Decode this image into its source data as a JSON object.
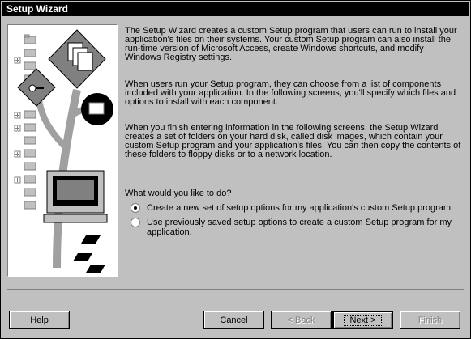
{
  "window": {
    "title": "Setup Wizard"
  },
  "intro": {
    "p1": "The Setup Wizard creates a custom Setup program that users can run to install your application's files on their systems.  Your custom Setup program can also install the run-time version of Microsoft Access, create Windows shortcuts, and modify Windows Registry settings.",
    "p2": "When users run your Setup program, they can choose from a list of components included with your application.  In the following screens, you'll specify which files and options to install with each component.",
    "p3": "When you finish entering information in the following screens, the Setup Wizard creates a set of folders on your hard disk, called disk images, which contain your custom Setup program and your application's files.  You can then copy the contents of these folders to floppy disks or to a network location."
  },
  "question": "What would you like to do?",
  "options": [
    {
      "label": "Create a new set of setup options for my application's custom Setup program.",
      "selected": true
    },
    {
      "label": "Use previously saved setup options to create a custom Setup program for my application.",
      "selected": false
    }
  ],
  "buttons": {
    "help": "Help",
    "cancel": "Cancel",
    "back": "< Back",
    "next": "Next >",
    "finish": "Finish"
  },
  "illustration_icons": [
    "folder-icon",
    "tree-expand-icon",
    "document-icon",
    "key-icon",
    "people-icon",
    "computer-icon",
    "floppy-disk-icon"
  ]
}
